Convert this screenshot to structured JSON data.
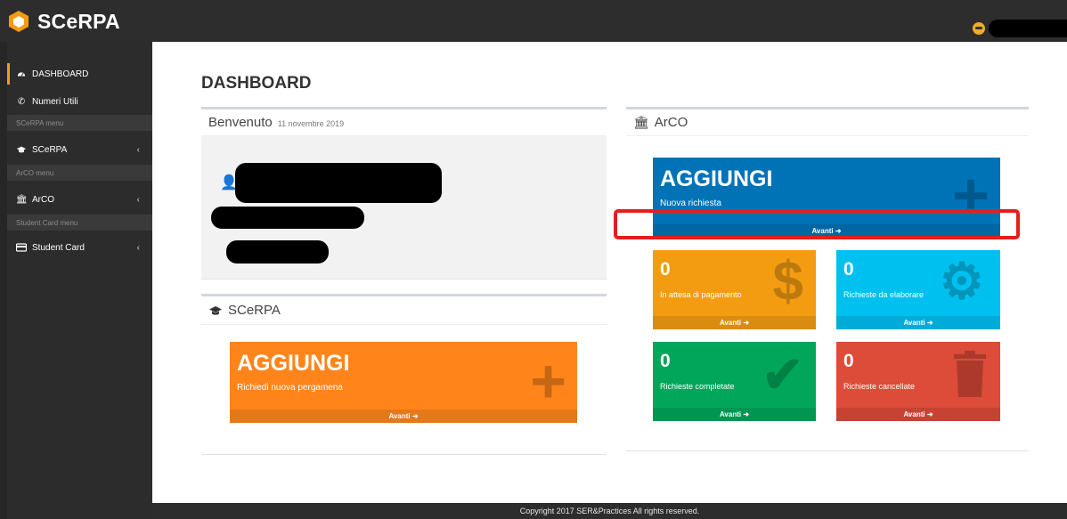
{
  "header": {
    "brand_name": "SCeRPA"
  },
  "sidebar": {
    "items": [
      {
        "label": "DASHBOARD",
        "icon": "dashboard-icon"
      },
      {
        "label": "Numeri Utili",
        "icon": "phone-icon"
      },
      {
        "header": "SCeRPA menu"
      },
      {
        "label": "SCeRPA",
        "icon": "graduation-cap-icon"
      },
      {
        "header": "ArCO menu"
      },
      {
        "label": "ArCO",
        "icon": "institution-icon"
      },
      {
        "header": "Student Card menu"
      },
      {
        "label": "Student Card",
        "icon": "card-icon"
      }
    ]
  },
  "main": {
    "title": "DASHBOARD",
    "welcome": {
      "title": "Benvenuto",
      "date": "11 novembre 2019"
    },
    "scerpa_panel": {
      "title": "SCeRPA",
      "tile": {
        "big": "AGGIUNGI",
        "sub": "Richiedi nuova pergamena",
        "footer": "Avanti ➜",
        "color": "#ff851b"
      }
    },
    "arco_panel": {
      "title": "ArCO",
      "tiles": [
        {
          "big": "AGGIUNGI",
          "sub": "Nuova richiesta",
          "footer": "Avanti ➜",
          "color": "#0073b7"
        },
        {
          "big": "0",
          "sub": "In attesa di pagamento",
          "footer": "Avanti ➜",
          "color": "#f39c12"
        },
        {
          "big": "0",
          "sub": "Richieste da elaborare",
          "footer": "Avanti ➜",
          "color": "#00c0ef"
        },
        {
          "big": "0",
          "sub": "Richieste completate",
          "footer": "Avanti ➜",
          "color": "#00a65a"
        },
        {
          "big": "0",
          "sub": "Richieste cancellate",
          "footer": "Avanti ➜",
          "color": "#dd4b39"
        }
      ]
    }
  },
  "footer": {
    "copyright": "Copyright 2017 SER&Practices All rights reserved."
  }
}
